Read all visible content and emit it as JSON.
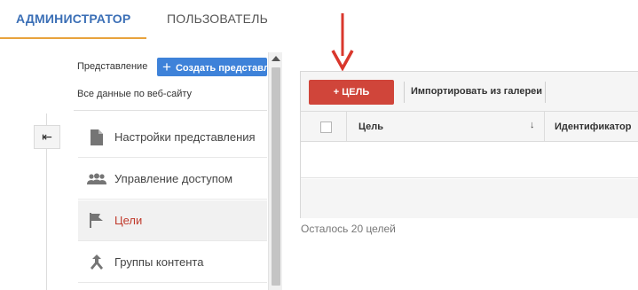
{
  "tabs": {
    "admin": "АДМИНИСТРАТОР",
    "user": "ПОЛЬЗОВАТЕЛЬ"
  },
  "view_panel": {
    "label": "Представление",
    "create_button": "Создать представл",
    "site_data": "Все данные по веб-сайту"
  },
  "menu": [
    {
      "label": "Настройки представления",
      "icon": "document-icon"
    },
    {
      "label": "Управление доступом",
      "icon": "people-icon"
    },
    {
      "label": "Цели",
      "icon": "flag-icon",
      "active": true
    },
    {
      "label": "Группы контента",
      "icon": "content-groups-icon"
    }
  ],
  "goals": {
    "add_button": "+ ЦЕЛЬ",
    "import_link": "Импортировать из галереи",
    "columns": {
      "goal": "Цель",
      "id": "Идентификатор"
    },
    "remaining": "Осталось 20 целей"
  },
  "colors": {
    "accent_blue": "#3b6fb6",
    "tab_underline": "#e8a33d",
    "add_goal_red": "#d0453a",
    "active_red": "#c0392b",
    "annotation_arrow": "#d9372c"
  }
}
